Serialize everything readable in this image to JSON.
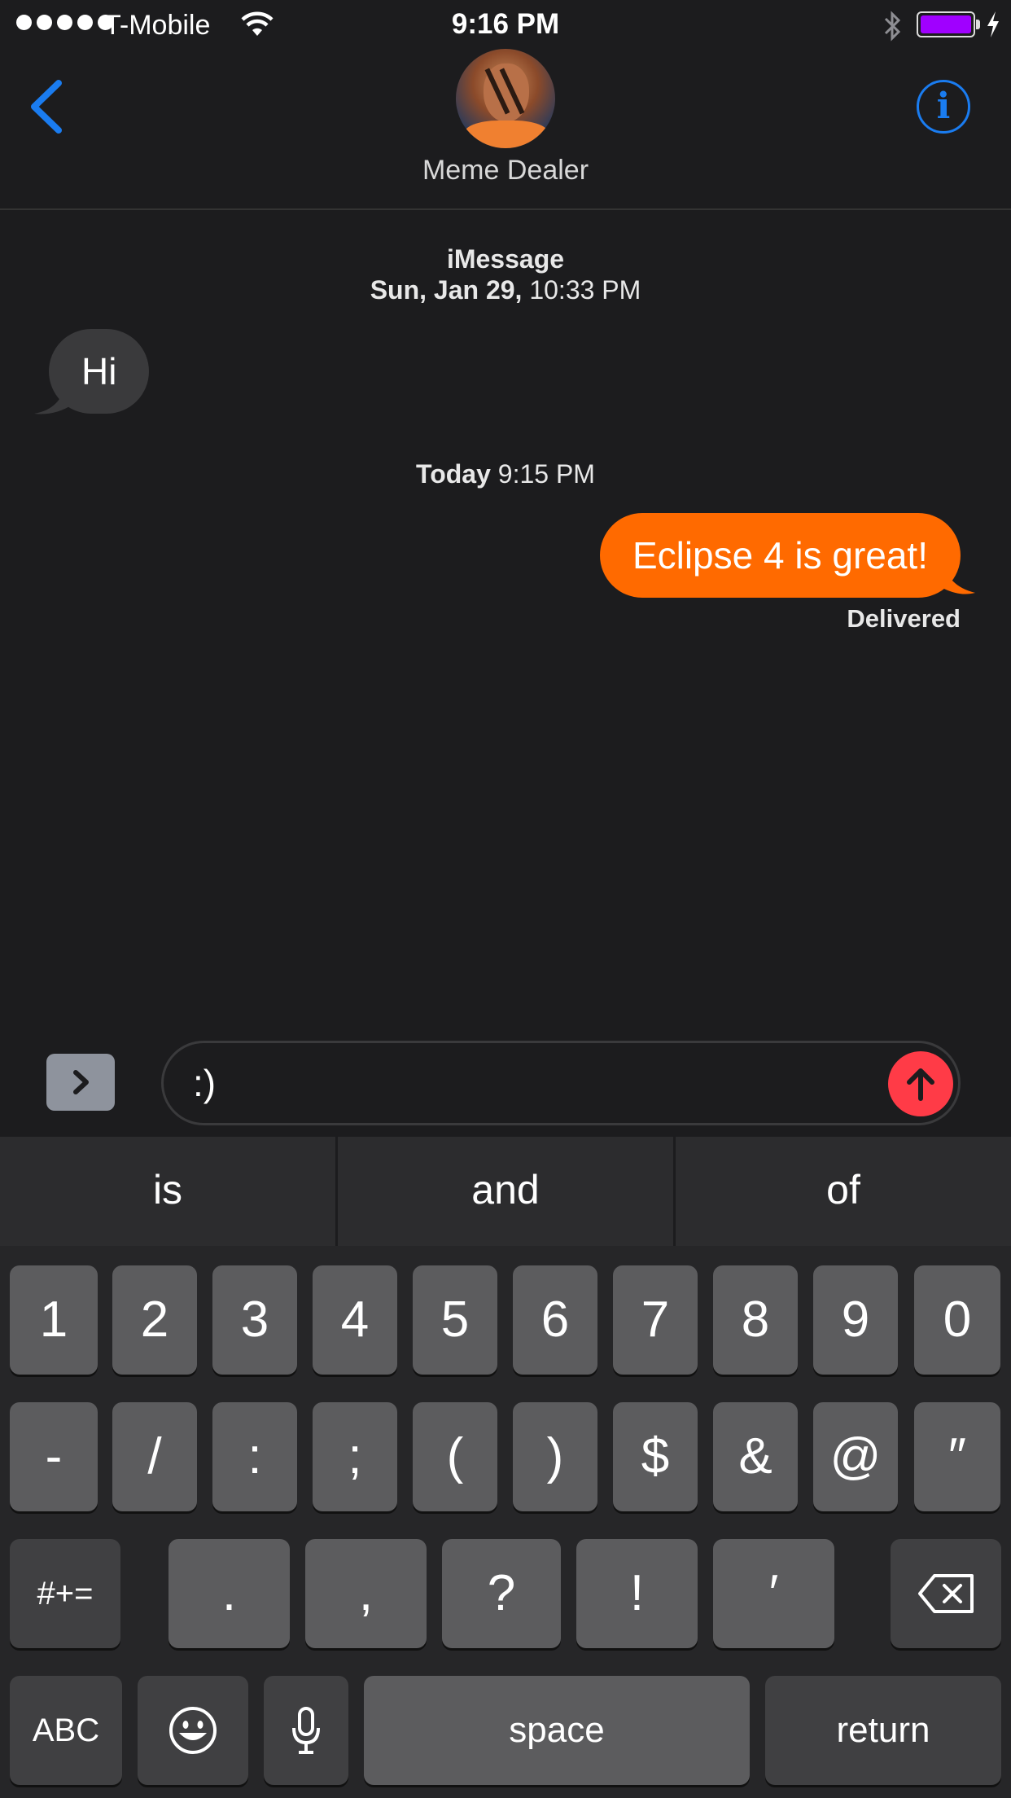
{
  "status_bar": {
    "carrier": "T-Mobile",
    "time": "9:16 PM",
    "battery_color": "#a000ff"
  },
  "nav": {
    "contact_name": "Meme Dealer",
    "info_label": "i"
  },
  "conversation": {
    "service": "iMessage",
    "first_date_bold": "Sun, Jan 29,",
    "first_time": "10:33 PM",
    "incoming_message": "Hi",
    "second_date_bold": "Today",
    "second_time": "9:15 PM",
    "outgoing_message": "Eclipse 4 is great!",
    "delivery_status": "Delivered"
  },
  "compose": {
    "text": ":)"
  },
  "keyboard": {
    "suggestions": [
      "is",
      "and",
      "of"
    ],
    "row1": [
      "1",
      "2",
      "3",
      "4",
      "5",
      "6",
      "7",
      "8",
      "9",
      "0"
    ],
    "row2": [
      "-",
      "/",
      ":",
      ";",
      "(",
      ")",
      "$",
      "&",
      "@",
      "″"
    ],
    "row3": {
      "toggle": "#+=",
      "keys": [
        ".",
        ",",
        "?",
        "!",
        "′"
      ]
    },
    "row4": {
      "abc": "ABC",
      "space": "space",
      "return": "return"
    }
  },
  "colors": {
    "accent_blue": "#1a7cf0",
    "outgoing_bubble": "#ff6a00",
    "send_button": "#ff3b47"
  }
}
